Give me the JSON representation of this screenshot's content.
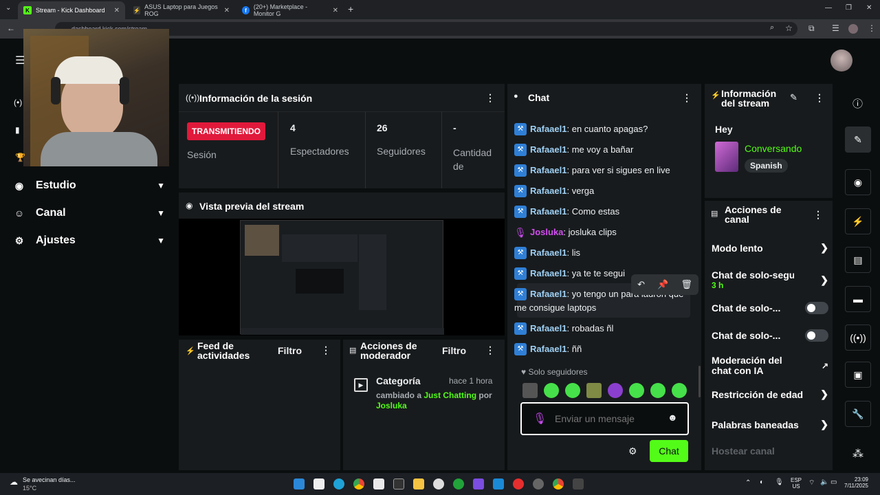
{
  "browser": {
    "tabs": [
      {
        "title": "Stream - Kick Dashboard",
        "favicon": "K",
        "favcolor": "#53fc18"
      },
      {
        "title": "ASUS Laptop para Juegos ROG",
        "favicon": "⚡",
        "favcolor": "#3a3a3a"
      },
      {
        "title": "(20+) Marketplace - Monitor G",
        "favicon": "f",
        "favcolor": "#1877f2"
      }
    ],
    "url": "dashboard.kick.com/stream"
  },
  "nav": {
    "items": [
      {
        "label": "Estudio"
      },
      {
        "label": "Canal"
      },
      {
        "label": "Ajustes"
      }
    ]
  },
  "session": {
    "title": "Información de la sesión",
    "status_badge": "TRANSMITIENDO",
    "status_label": "Sesión",
    "stats": [
      {
        "value": "4",
        "label": "Espectadores"
      },
      {
        "value": "26",
        "label": "Seguidores"
      },
      {
        "value": "-",
        "label": "Cantidad de suscripciones"
      }
    ]
  },
  "preview": {
    "title": "Vista previa del stream"
  },
  "feed": {
    "title": "Feed de actividades",
    "filter": "Filtro"
  },
  "modactions": {
    "title": "Acciones de moderador",
    "filter": "Filtro",
    "entry": {
      "heading": "Categoría",
      "time": "hace 1 hora",
      "text_prefix": "cambiado a",
      "category": "Just Chatting",
      "by": "por",
      "user": "Josluka"
    }
  },
  "chat": {
    "title": "Chat",
    "messages": [
      {
        "user": "Rafaael1",
        "text": "en cuanto apagas?",
        "badge": "hammer"
      },
      {
        "user": "Rafaael1",
        "text": "me voy a bañar",
        "badge": "hammer"
      },
      {
        "user": "Rafaael1",
        "text": "para ver si sigues en live",
        "badge": "hammer"
      },
      {
        "user": "Rafaael1",
        "text": "verga",
        "badge": "hammer"
      },
      {
        "user": "Rafaael1",
        "text": "Como estas",
        "badge": "hammer"
      },
      {
        "user": "Josluka",
        "text": "josluka clips",
        "badge": "mic"
      },
      {
        "user": "Rafaael1",
        "text": "lis",
        "badge": "hammer"
      },
      {
        "user": "Rafaael1",
        "text": "ya te te segui",
        "badge": "hammer"
      },
      {
        "user": "Rafaael1",
        "text": "yo tengo un para ladron que me consigue laptops",
        "badge": "hammer"
      },
      {
        "user": "Rafaael1",
        "text": "robadas ñl",
        "badge": "hammer"
      },
      {
        "user": "Rafaael1",
        "text": "ññ",
        "badge": "hammer"
      }
    ],
    "followers_only": "Solo seguidores",
    "input_placeholder": "Enviar un mensaje",
    "send_label": "Chat"
  },
  "stream_info": {
    "title": "Información del stream",
    "stream_title": "Hey",
    "category": "Conversando",
    "language": "Spanish"
  },
  "channel_actions": {
    "title": "Acciones de canal",
    "rows": [
      {
        "label": "Modo lento"
      },
      {
        "label": "Chat de solo-seguido",
        "sub": "3 h"
      },
      {
        "label": "Chat de solo-..."
      },
      {
        "label": "Chat de solo-..."
      },
      {
        "label": "Moderación del chat con IA"
      },
      {
        "label": "Restricción de edad"
      },
      {
        "label": "Palabras baneadas"
      },
      {
        "label": "Hostear canal"
      }
    ]
  },
  "taskbar": {
    "weather_text": "Se avecinan días...",
    "weather_temp": "15°C",
    "lang": "ESP",
    "region": "US",
    "time": "23:09",
    "date": "7/11/2025"
  }
}
